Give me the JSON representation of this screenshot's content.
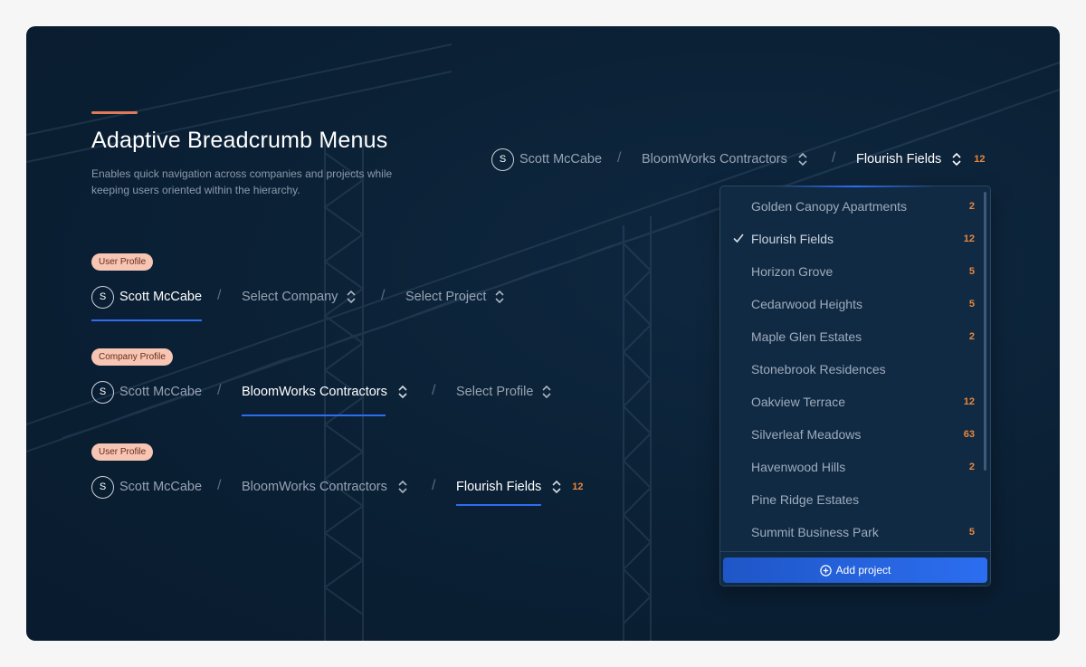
{
  "header": {
    "title": "Adaptive Breadcrumb Menus",
    "subtitle": "Enables quick navigation across companies and projects while keeping users oriented within the hierarchy."
  },
  "rows": [
    {
      "badge": "User Profile",
      "crumbs": [
        {
          "avatar": "S",
          "label": "Scott McCabe",
          "active": true
        },
        {
          "label": "Select Company",
          "icon": "chevron-up-down-icon"
        },
        {
          "label": "Select Project",
          "icon": "chevron-up-down-icon"
        }
      ]
    },
    {
      "badge": "Company Profile",
      "crumbs": [
        {
          "avatar": "S",
          "label": "Scott McCabe"
        },
        {
          "label": "BloomWorks Contractors",
          "icon": "chevron-up-down-icon",
          "active": true
        },
        {
          "label": "Select Profile",
          "icon": "chevron-up-down-icon"
        }
      ]
    },
    {
      "badge": "User Profile",
      "crumbs": [
        {
          "avatar": "S",
          "label": "Scott McCabe"
        },
        {
          "label": "BloomWorks Contractors",
          "icon": "chevron-up-down-icon"
        },
        {
          "label": "Flourish Fields",
          "icon": "chevron-up-down-icon",
          "count": "12",
          "active": true
        }
      ]
    }
  ],
  "top_breadcrumb": {
    "avatar": "S",
    "user": "Scott McCabe",
    "company": "BloomWorks Contractors",
    "project": "Flourish Fields",
    "project_count": "12",
    "separator": "/"
  },
  "dropdown": {
    "items": [
      {
        "label": "Golden Canopy Apartments",
        "count": "2"
      },
      {
        "label": "Flourish Fields",
        "count": "12",
        "selected": true
      },
      {
        "label": "Horizon Grove",
        "count": "5"
      },
      {
        "label": "Cedarwood Heights",
        "count": "5"
      },
      {
        "label": "Maple Glen Estates",
        "count": "2"
      },
      {
        "label": "Stonebrook Residences",
        "count": ""
      },
      {
        "label": "Oakview Terrace",
        "count": "12"
      },
      {
        "label": "Silverleaf Meadows",
        "count": "63"
      },
      {
        "label": "Havenwood Hills",
        "count": "2"
      },
      {
        "label": "Pine Ridge Estates",
        "count": ""
      },
      {
        "label": "Summit Business Park",
        "count": "5"
      }
    ],
    "add_label": "Add project"
  },
  "colors": {
    "background": "#0b2136",
    "accent": "#e07a5a",
    "underline": "#2f6df0",
    "count": "#e8873d",
    "badge": "#f6c5b3"
  }
}
